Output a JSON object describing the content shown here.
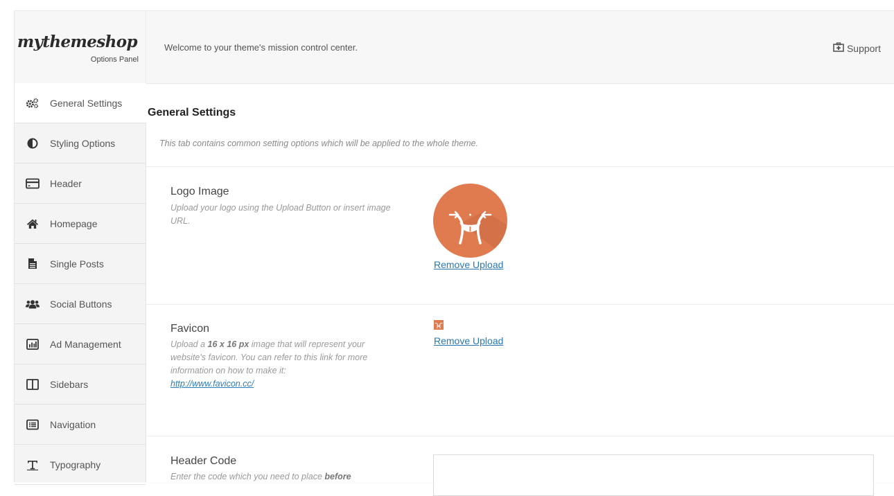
{
  "brand": {
    "name": "mythemeshop",
    "subtitle": "Options Panel"
  },
  "header": {
    "welcome": "Welcome to your theme's mission control center.",
    "support_label": "Support",
    "support_icon": "support-kit-icon"
  },
  "sidebar": {
    "items": [
      {
        "label": "General Settings",
        "icon": "gears-icon",
        "active": true
      },
      {
        "label": "Styling Options",
        "icon": "contrast-icon"
      },
      {
        "label": "Header",
        "icon": "header-layout-icon"
      },
      {
        "label": "Homepage",
        "icon": "home-icon"
      },
      {
        "label": "Single Posts",
        "icon": "document-icon"
      },
      {
        "label": "Social Buttons",
        "icon": "users-icon"
      },
      {
        "label": "Ad Management",
        "icon": "bar-chart-icon"
      },
      {
        "label": "Sidebars",
        "icon": "columns-icon"
      },
      {
        "label": "Navigation",
        "icon": "list-icon"
      },
      {
        "label": "Typography",
        "icon": "text-icon"
      }
    ]
  },
  "main": {
    "title": "General Settings",
    "description": "This tab contains common setting options which will be applied to the whole theme.",
    "logo": {
      "title": "Logo Image",
      "description": "Upload your logo using the Upload Button or insert image URL.",
      "remove_label": "Remove Upload"
    },
    "favicon": {
      "title": "Favicon",
      "desc_pre": "Upload a ",
      "desc_bold": "16 x 16 px",
      "desc_post": " image that will represent your website's favicon. You can refer to this link for more information on how to make it:",
      "link": "http://www.favicon.cc/",
      "remove_label": "Remove Upload"
    },
    "header_code": {
      "title": "Header Code",
      "desc_pre": "Enter the code which you need to place ",
      "desc_bold": "before",
      "value": ""
    }
  },
  "colors": {
    "accent": "#e07a4f",
    "link": "#2778b4"
  }
}
